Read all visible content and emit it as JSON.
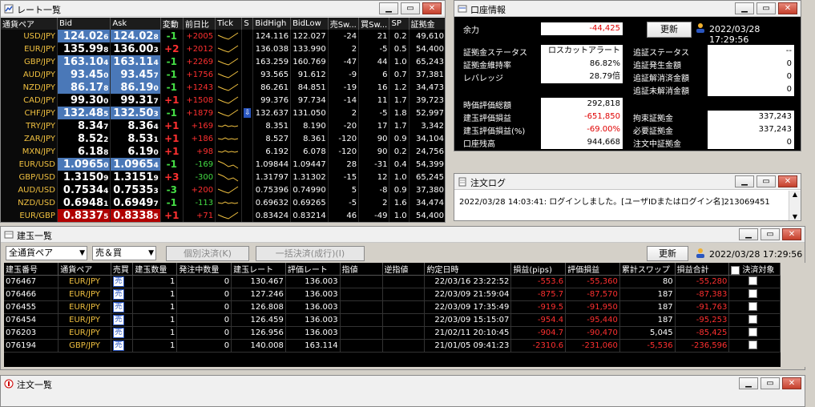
{
  "rate_window": {
    "title": "レート一覧",
    "columns": [
      "通貨ペア",
      "Bid",
      "Ask",
      "変動",
      "前日比",
      "Tick",
      "S",
      "BidHigh",
      "BidLow",
      "売Sw...",
      "買Sw...",
      "SP",
      "証拠金"
    ],
    "rows": [
      {
        "pair": "USD/JPY",
        "bid_main": "124.02",
        "bid_last": "6",
        "ask_main": "124.02",
        "ask_last": "8",
        "chg": "-1",
        "diff": "+2005",
        "tick": "up",
        "s": "",
        "high": "124.116",
        "low": "122.027",
        "sell_sw": "-24",
        "buy_sw": "21",
        "sp": "0.2",
        "margin": "49,610",
        "bid_style": "hl",
        "ask_style": "hl"
      },
      {
        "pair": "EUR/JPY",
        "bid_main": "135.99",
        "bid_last": "8",
        "ask_main": "136.00",
        "ask_last": "3",
        "chg": "+2",
        "diff": "+2012",
        "tick": "up",
        "s": "",
        "high": "136.038",
        "low": "133.990",
        "sell_sw": "2",
        "buy_sw": "-5",
        "sp": "0.5",
        "margin": "54,400",
        "bid_style": "",
        "ask_style": ""
      },
      {
        "pair": "GBP/JPY",
        "bid_main": "163.10",
        "bid_last": "4",
        "ask_main": "163.11",
        "ask_last": "4",
        "chg": "-1",
        "diff": "+2269",
        "tick": "up",
        "s": "",
        "high": "163.259",
        "low": "160.769",
        "sell_sw": "-47",
        "buy_sw": "44",
        "sp": "1.0",
        "margin": "65,243",
        "bid_style": "hl",
        "ask_style": "hl"
      },
      {
        "pair": "AUD/JPY",
        "bid_main": "93.45",
        "bid_last": "0",
        "ask_main": "93.45",
        "ask_last": "7",
        "chg": "-1",
        "diff": "+1756",
        "tick": "up",
        "s": "",
        "high": "93.565",
        "low": "91.612",
        "sell_sw": "-9",
        "buy_sw": "6",
        "sp": "0.7",
        "margin": "37,381",
        "bid_style": "hl",
        "ask_style": "hl"
      },
      {
        "pair": "NZD/JPY",
        "bid_main": "86.17",
        "bid_last": "8",
        "ask_main": "86.19",
        "ask_last": "0",
        "chg": "-1",
        "diff": "+1243",
        "tick": "up",
        "s": "",
        "high": "86.261",
        "low": "84.851",
        "sell_sw": "-19",
        "buy_sw": "16",
        "sp": "1.2",
        "margin": "34,473",
        "bid_style": "hl",
        "ask_style": "hl"
      },
      {
        "pair": "CAD/JPY",
        "bid_main": "99.30",
        "bid_last": "0",
        "ask_main": "99.31",
        "ask_last": "7",
        "chg": "+1",
        "diff": "+1508",
        "tick": "up",
        "s": "",
        "high": "99.376",
        "low": "97.734",
        "sell_sw": "-14",
        "buy_sw": "11",
        "sp": "1.7",
        "margin": "39,723",
        "bid_style": "",
        "ask_style": ""
      },
      {
        "pair": "CHF/JPY",
        "bid_main": "132.48",
        "bid_last": "5",
        "ask_main": "132.50",
        "ask_last": "3",
        "chg": "-1",
        "diff": "+1879",
        "tick": "up",
        "s": "down",
        "high": "132.637",
        "low": "131.050",
        "sell_sw": "2",
        "buy_sw": "-5",
        "sp": "1.8",
        "margin": "52,997",
        "bid_style": "hl",
        "ask_style": "hl"
      },
      {
        "pair": "TRY/JPY",
        "bid_main": "8.34",
        "bid_last": "7",
        "ask_main": "8.36",
        "ask_last": "4",
        "chg": "+1",
        "diff": "+169",
        "tick": "flat",
        "s": "",
        "high": "8.351",
        "low": "8.190",
        "sell_sw": "-20",
        "buy_sw": "17",
        "sp": "1.7",
        "margin": "3,342",
        "bid_style": "",
        "ask_style": ""
      },
      {
        "pair": "ZAR/JPY",
        "bid_main": "8.52",
        "bid_last": "2",
        "ask_main": "8.53",
        "ask_last": "1",
        "chg": "+1",
        "diff": "+186",
        "tick": "flat",
        "s": "",
        "high": "8.527",
        "low": "8.361",
        "sell_sw": "-120",
        "buy_sw": "90",
        "sp": "0.9",
        "margin": "34,104",
        "bid_style": "",
        "ask_style": ""
      },
      {
        "pair": "MXN/JPY",
        "bid_main": "6.18",
        "bid_last": "8",
        "ask_main": "6.19",
        "ask_last": "0",
        "chg": "+1",
        "diff": "+98",
        "tick": "flat",
        "s": "",
        "high": "6.192",
        "low": "6.078",
        "sell_sw": "-120",
        "buy_sw": "90",
        "sp": "0.2",
        "margin": "24,756",
        "bid_style": "",
        "ask_style": ""
      },
      {
        "pair": "EUR/USD",
        "bid_main": "1.0965",
        "bid_last": "0",
        "ask_main": "1.0965",
        "ask_last": "4",
        "chg": "-1",
        "diff": "-169",
        "tick": "down",
        "s": "",
        "high": "1.09844",
        "low": "1.09447",
        "sell_sw": "28",
        "buy_sw": "-31",
        "sp": "0.4",
        "margin": "54,399",
        "bid_style": "hl",
        "ask_style": "hl"
      },
      {
        "pair": "GBP/USD",
        "bid_main": "1.3150",
        "bid_last": "9",
        "ask_main": "1.3151",
        "ask_last": "9",
        "chg": "+3",
        "diff": "-300",
        "tick": "down",
        "s": "",
        "high": "1.31797",
        "low": "1.31302",
        "sell_sw": "-15",
        "buy_sw": "12",
        "sp": "1.0",
        "margin": "65,245",
        "bid_style": "",
        "ask_style": ""
      },
      {
        "pair": "AUD/USD",
        "bid_main": "0.7534",
        "bid_last": "4",
        "ask_main": "0.7535",
        "ask_last": "3",
        "chg": "-3",
        "diff": "+200",
        "tick": "up",
        "s": "",
        "high": "0.75396",
        "low": "0.74990",
        "sell_sw": "5",
        "buy_sw": "-8",
        "sp": "0.9",
        "margin": "37,380",
        "bid_style": "",
        "ask_style": ""
      },
      {
        "pair": "NZD/USD",
        "bid_main": "0.6948",
        "bid_last": "1",
        "ask_main": "0.6949",
        "ask_last": "7",
        "chg": "-1",
        "diff": "-113",
        "tick": "flat",
        "s": "",
        "high": "0.69632",
        "low": "0.69265",
        "sell_sw": "-5",
        "buy_sw": "2",
        "sp": "1.6",
        "margin": "34,474",
        "bid_style": "",
        "ask_style": ""
      },
      {
        "pair": "EUR/GBP",
        "bid_main": "0.8337",
        "bid_last": "5",
        "ask_main": "0.8338",
        "ask_last": "5",
        "chg": "+1",
        "diff": "+71",
        "tick": "up",
        "s": "",
        "high": "0.83424",
        "low": "0.83214",
        "sell_sw": "46",
        "buy_sw": "-49",
        "sp": "1.0",
        "margin": "54,400",
        "bid_style": "red",
        "ask_style": "red"
      }
    ]
  },
  "account_window": {
    "title": "口座情報",
    "yoryoku_label": "余力",
    "yoryoku_value": "-44,425",
    "refresh_label": "更新",
    "datetime": "2022/03/28 17:29:56",
    "left_block1": [
      {
        "label": "証拠金ステータス",
        "value": "ロスカットアラート",
        "neg": false
      },
      {
        "label": "証拠金維持率",
        "value": "86.82%",
        "neg": false
      },
      {
        "label": "レバレッジ",
        "value": "28.79倍",
        "neg": false
      }
    ],
    "right_block1": [
      {
        "label": "追証ステータス",
        "value": "--"
      },
      {
        "label": "追証発生金額",
        "value": "0"
      },
      {
        "label": "追証解消済金額",
        "value": "0"
      },
      {
        "label": "追証未解消金額",
        "value": "0"
      }
    ],
    "left_block2": [
      {
        "label": "時価評価総額",
        "value": "292,818",
        "neg": false
      },
      {
        "label": "建玉評価損益",
        "value": "-651,850",
        "neg": true
      },
      {
        "label": "建玉評価損益(%)",
        "value": "-69.00%",
        "neg": true
      },
      {
        "label": "口座残高",
        "value": "944,668",
        "neg": false
      }
    ],
    "right_block2": [
      {
        "label": "拘束証拠金",
        "value": "337,243"
      },
      {
        "label": "必要証拠金",
        "value": "337,243"
      },
      {
        "label": "注文中証拠金",
        "value": "0"
      }
    ]
  },
  "log_window": {
    "title": "注文ログ",
    "message": "2022/03/28 14:03:41: ログインしました。[ユーザIDまたはログイン名]213069451"
  },
  "positions_window": {
    "title": "建玉一覧",
    "pair_filter": "全通貨ペア",
    "side_filter": "売＆買",
    "individual_btn": "個別決済(K)",
    "bulk_btn": "一括決済(成行)(I)",
    "refresh_label": "更新",
    "datetime": "2022/03/28 17:29:56",
    "columns": [
      "建玉番号",
      "通貨ペア",
      "売買",
      "建玉数量",
      "発注中数量",
      "建玉レート",
      "評価レート",
      "指値",
      "逆指値",
      "約定日時",
      "損益(pips)",
      "評価損益",
      "累計スワップ",
      "損益合計",
      "決済対象"
    ],
    "rows": [
      {
        "id": "076467",
        "pair": "EUR/JPY",
        "side": "売",
        "qty": "1",
        "pending": "0",
        "rate": "130.467",
        "eval": "136.003",
        "limit": "",
        "stop": "",
        "date": "22/03/16 23:22:52",
        "pips": "-553.6",
        "pl": "-55,360",
        "swap": "80",
        "total": "-55,280"
      },
      {
        "id": "076466",
        "pair": "EUR/JPY",
        "side": "売",
        "qty": "1",
        "pending": "0",
        "rate": "127.246",
        "eval": "136.003",
        "limit": "",
        "stop": "",
        "date": "22/03/09 21:59:04",
        "pips": "-875.7",
        "pl": "-87,570",
        "swap": "187",
        "total": "-87,383"
      },
      {
        "id": "076455",
        "pair": "EUR/JPY",
        "side": "売",
        "qty": "1",
        "pending": "0",
        "rate": "126.808",
        "eval": "136.003",
        "limit": "",
        "stop": "",
        "date": "22/03/09 17:35:49",
        "pips": "-919.5",
        "pl": "-91,950",
        "swap": "187",
        "total": "-91,763"
      },
      {
        "id": "076454",
        "pair": "EUR/JPY",
        "side": "売",
        "qty": "1",
        "pending": "0",
        "rate": "126.459",
        "eval": "136.003",
        "limit": "",
        "stop": "",
        "date": "22/03/09 15:15:07",
        "pips": "-954.4",
        "pl": "-95,440",
        "swap": "187",
        "total": "-95,253"
      },
      {
        "id": "076203",
        "pair": "EUR/JPY",
        "side": "売",
        "qty": "1",
        "pending": "0",
        "rate": "126.956",
        "eval": "136.003",
        "limit": "",
        "stop": "",
        "date": "21/02/11 20:10:45",
        "pips": "-904.7",
        "pl": "-90,470",
        "swap": "5,045",
        "total": "-85,425"
      },
      {
        "id": "076194",
        "pair": "GBP/JPY",
        "side": "売",
        "qty": "1",
        "pending": "0",
        "rate": "140.008",
        "eval": "163.114",
        "limit": "",
        "stop": "",
        "date": "21/01/05 09:41:23",
        "pips": "-2310.6",
        "pl": "-231,060",
        "swap": "-5,536",
        "total": "-236,596"
      }
    ]
  },
  "orders_window": {
    "title": "注文一覧"
  },
  "colors": {
    "hl_blue": "#4a78b8",
    "alert_red": "#b00000",
    "pair_gold": "#f0c040",
    "neg_red": "#e00000"
  },
  "icons": {
    "minimize": "minimize-icon",
    "maximize": "maximize-icon",
    "close": "close-icon"
  }
}
